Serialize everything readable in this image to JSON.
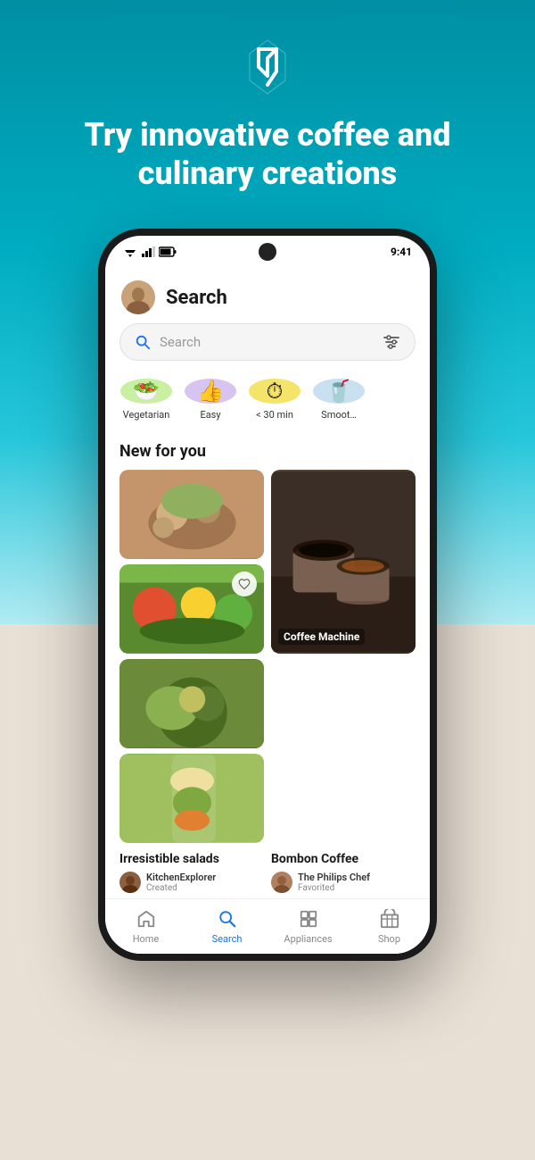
{
  "app": {
    "tagline": "Try innovative coffee and culinary creations"
  },
  "status_bar": {
    "time": "9:41"
  },
  "header": {
    "page_title": "Search"
  },
  "search": {
    "placeholder": "Search"
  },
  "categories": [
    {
      "id": "vegetarian",
      "label": "Vegetarian",
      "color_class": "chip-green",
      "emoji": "🥗"
    },
    {
      "id": "easy",
      "label": "Easy",
      "color_class": "chip-purple",
      "emoji": "👍"
    },
    {
      "id": "quick",
      "label": "< 30 min",
      "color_class": "chip-yellow",
      "emoji": "⏱"
    },
    {
      "id": "smoothie",
      "label": "Smoot…",
      "color_class": "chip-blue",
      "emoji": "🥤"
    }
  ],
  "section": {
    "new_for_you": "New for you"
  },
  "recipes": [
    {
      "id": "salads",
      "title": "Irresistible salads",
      "author": "KitchenExplorer",
      "action": "Created"
    },
    {
      "id": "coffee",
      "title": "Bombon Coffee",
      "author": "The Philips Chef",
      "action": "Favorited",
      "badge": "Coffee Machine"
    }
  ],
  "bottom_nav": [
    {
      "id": "home",
      "label": "Home",
      "active": false
    },
    {
      "id": "search",
      "label": "Search",
      "active": true
    },
    {
      "id": "appliances",
      "label": "Appliances",
      "active": false
    },
    {
      "id": "shop",
      "label": "Shop",
      "active": false
    }
  ]
}
